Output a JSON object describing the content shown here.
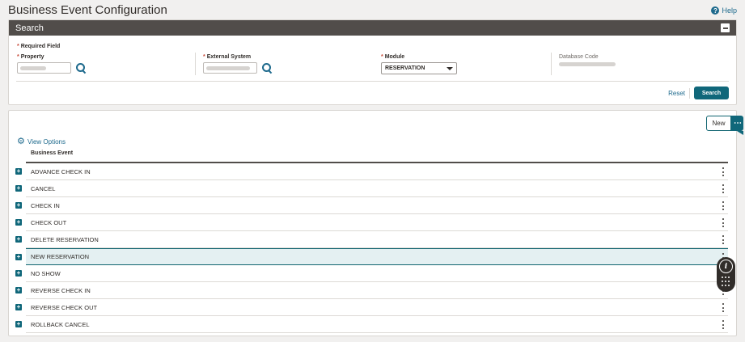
{
  "header": {
    "title": "Business Event Configuration",
    "help_label": "Help",
    "help_icon": "question-circle-icon"
  },
  "search": {
    "title": "Search",
    "required_note": "Required Field",
    "property": {
      "label": "Property",
      "required": true
    },
    "external_system": {
      "label": "External System",
      "required": true
    },
    "module": {
      "label": "Module",
      "required": true,
      "value": "RESERVATION"
    },
    "database_code": {
      "label": "Database Code"
    },
    "reset_label": "Reset",
    "search_label": "Search"
  },
  "results": {
    "new_label": "New",
    "more_label": "⋯",
    "view_options_label": "View Options",
    "column_header": "Business Event",
    "rows": [
      {
        "label": "ADVANCE CHECK IN"
      },
      {
        "label": "CANCEL"
      },
      {
        "label": "CHECK IN"
      },
      {
        "label": "CHECK OUT"
      },
      {
        "label": "DELETE RESERVATION"
      },
      {
        "label": "NEW RESERVATION",
        "selected": true
      },
      {
        "label": "NO SHOW"
      },
      {
        "label": "REVERSE CHECK IN"
      },
      {
        "label": "REVERSE CHECK OUT"
      },
      {
        "label": "ROLLBACK CANCEL"
      }
    ]
  },
  "floating_widget": {
    "info_glyph": "i"
  },
  "colors": {
    "accent": "#10677a",
    "header_bar": "#514d4a",
    "link": "#1e6a8d",
    "required": "#c74634",
    "selected_row": "#e4f0f2"
  }
}
